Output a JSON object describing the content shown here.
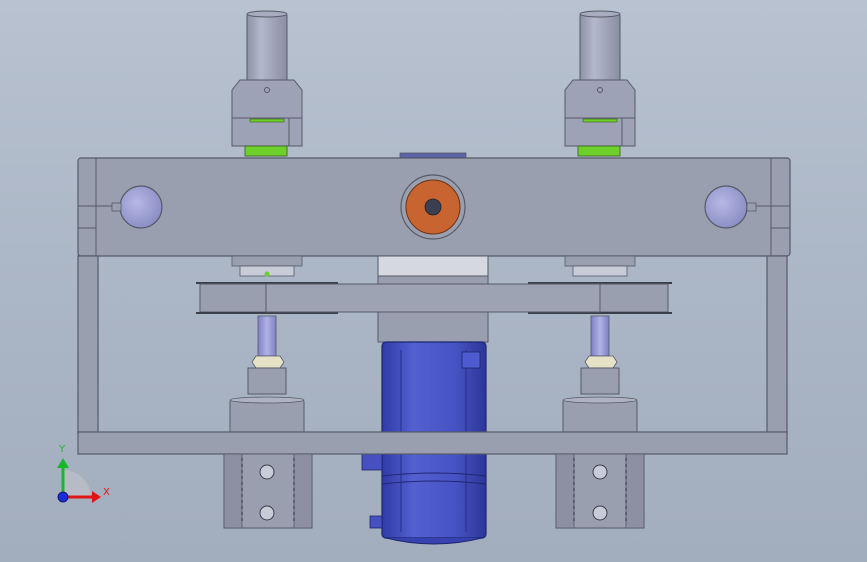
{
  "triad": {
    "y_label": "Y",
    "x_label": "X",
    "y_color": "#18b82a",
    "x_color": "#e01616",
    "z_color": "#1a2bd8"
  },
  "colors": {
    "frame": "#9a9fb0",
    "frame_dark": "#555a66",
    "motor": "#4450c0",
    "bearing": "#c86430",
    "green_ring": "#6ccf2a",
    "knob": "#9a9ed0"
  }
}
